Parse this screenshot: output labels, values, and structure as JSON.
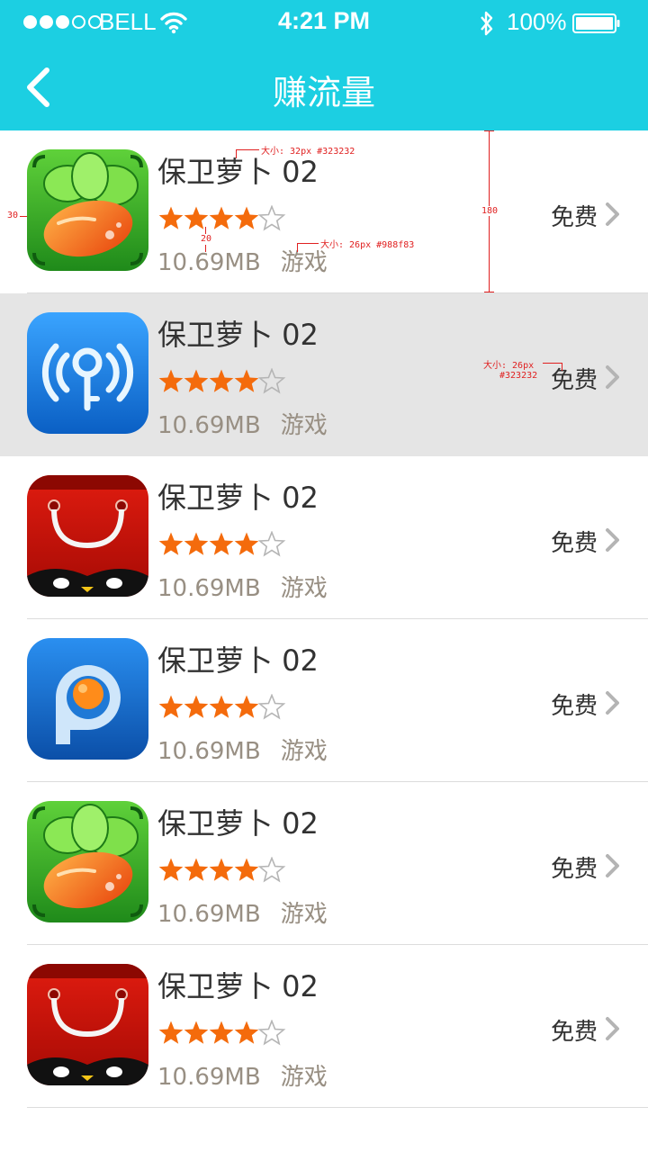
{
  "status_bar": {
    "carrier": "BELL",
    "time": "4:21 PM",
    "battery": "100%",
    "signal_bars": 3,
    "signal_total": 5,
    "icons": [
      "wifi-icon",
      "bluetooth-icon",
      "battery-icon"
    ]
  },
  "nav": {
    "title": "赚流量",
    "back_icon": "chevron-left-icon"
  },
  "colors": {
    "accent": "#1ccfe2",
    "name_text": "#323232",
    "meta_text": "#988f83",
    "star": "#f46b0c",
    "highlight_row": "#e5e5e5"
  },
  "apps": [
    {
      "name": "保卫萝卜 02",
      "size": "10.69MB",
      "category": "游戏",
      "price": "免费",
      "rating": 4,
      "rating_max": 5,
      "icon": "carrot-game-icon"
    },
    {
      "name": "保卫萝卜 02",
      "size": "10.69MB",
      "category": "游戏",
      "price": "免费",
      "rating": 4,
      "rating_max": 5,
      "icon": "wifi-key-icon"
    },
    {
      "name": "保卫萝卜 02",
      "size": "10.69MB",
      "category": "游戏",
      "price": "免费",
      "rating": 4,
      "rating_max": 5,
      "icon": "shopping-bag-icon"
    },
    {
      "name": "保卫萝卜 02",
      "size": "10.69MB",
      "category": "游戏",
      "price": "免费",
      "rating": 4,
      "rating_max": 5,
      "icon": "pptv-player-icon"
    },
    {
      "name": "保卫萝卜 02",
      "size": "10.69MB",
      "category": "游戏",
      "price": "免费",
      "rating": 4,
      "rating_max": 5,
      "icon": "carrot-game-icon"
    },
    {
      "name": "保卫萝卜 02",
      "size": "10.69MB",
      "category": "游戏",
      "price": "免费",
      "rating": 4,
      "rating_max": 5,
      "icon": "shopping-bag-icon"
    }
  ],
  "annotations": {
    "name_spec": "大小: 32px #323232",
    "meta_spec": "大小: 26px #988f83",
    "price_spec_size": "大小: 26px",
    "price_spec_color": "#323232",
    "left_margin": "30",
    "row_height": "180",
    "star_gap": "20"
  }
}
